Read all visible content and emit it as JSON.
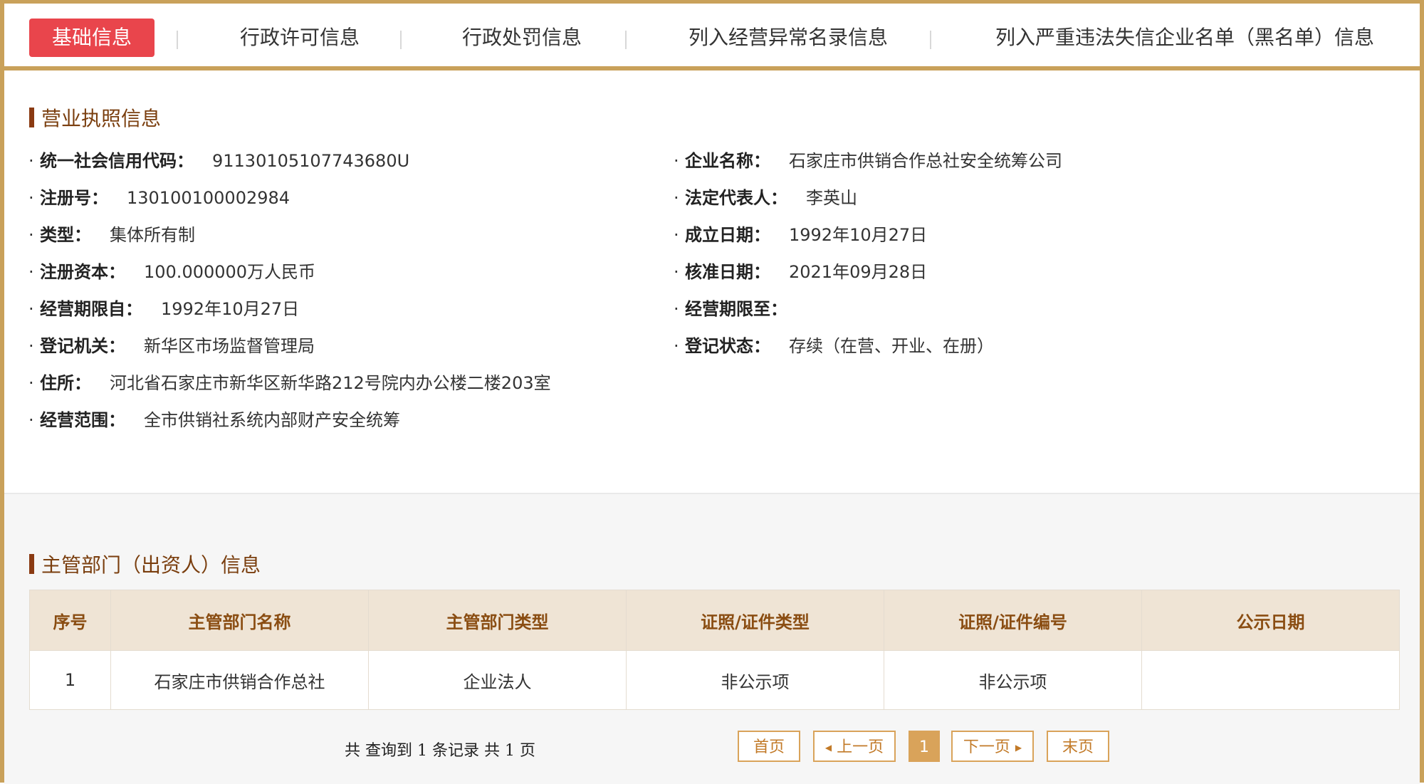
{
  "tabs": [
    {
      "label": "基础信息"
    },
    {
      "label": "行政许可信息"
    },
    {
      "label": "行政处罚信息"
    },
    {
      "label": "列入经营异常名录信息"
    },
    {
      "label": "列入严重违法失信企业名单（黑名单）信息"
    }
  ],
  "license": {
    "title": "营业执照信息",
    "left": [
      {
        "label": "统一社会信用代码：",
        "value": "91130105107743680U"
      },
      {
        "label": "注册号：",
        "value": "130100100002984"
      },
      {
        "label": "类型：",
        "value": "集体所有制"
      },
      {
        "label": "注册资本：",
        "value": "100.000000万人民币"
      },
      {
        "label": "经营期限自：",
        "value": "1992年10月27日"
      },
      {
        "label": "登记机关：",
        "value": "新华区市场监督管理局"
      },
      {
        "label": "住所：",
        "value": "河北省石家庄市新华区新华路212号院内办公楼二楼203室"
      },
      {
        "label": "经营范围：",
        "value": "全市供销社系统内部财产安全统筹"
      }
    ],
    "right": [
      {
        "label": "企业名称：",
        "value": "石家庄市供销合作总社安全统筹公司"
      },
      {
        "label": "法定代表人：",
        "value": "李英山"
      },
      {
        "label": "成立日期：",
        "value": "1992年10月27日"
      },
      {
        "label": "核准日期：",
        "value": "2021年09月28日"
      },
      {
        "label": "经营期限至：",
        "value": ""
      },
      {
        "label": "登记状态：",
        "value": "存续（在营、开业、在册）"
      }
    ]
  },
  "investors": {
    "title": "主管部门（出资人）信息",
    "columns": [
      "序号",
      "主管部门名称",
      "主管部门类型",
      "证照/证件类型",
      "证照/证件编号",
      "公示日期"
    ],
    "rows": [
      [
        "1",
        "石家庄市供销合作总社",
        "企业法人",
        "非公示项",
        "非公示项",
        ""
      ]
    ]
  },
  "pagination": {
    "summary": "共 查询到 1 条记录 共 1 页",
    "first": "首页",
    "prev": "上一页",
    "current": "1",
    "next": "下一页",
    "last": "末页"
  }
}
